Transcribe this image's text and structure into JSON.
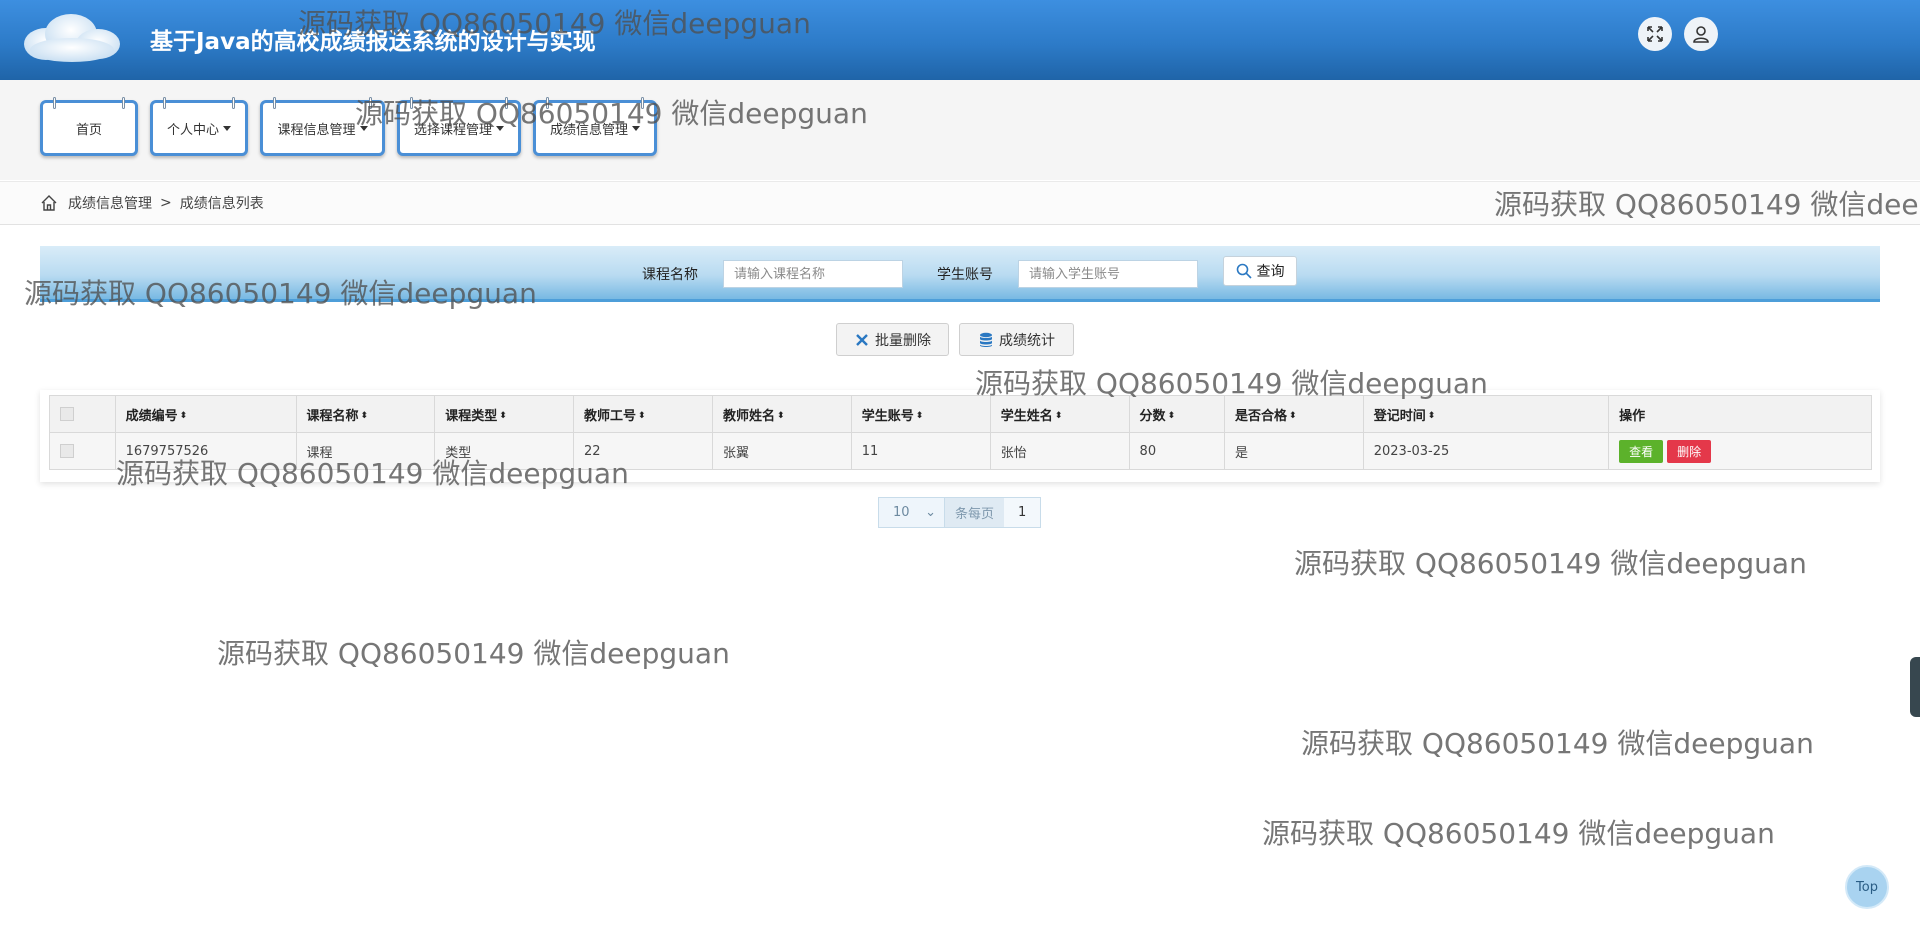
{
  "header": {
    "title": "基于Java的高校成绩报送系统的设计与实现",
    "fullscreen_icon": "expand-arrows-icon",
    "user_icon": "user-icon"
  },
  "nav": {
    "tabs": [
      {
        "label": "首页",
        "has_dropdown": false
      },
      {
        "label": "个人中心",
        "has_dropdown": true
      },
      {
        "label": "课程信息管理",
        "has_dropdown": true
      },
      {
        "label": "选择课程管理",
        "has_dropdown": true
      },
      {
        "label": "成绩信息管理",
        "has_dropdown": true
      }
    ]
  },
  "breadcrumb": {
    "home_icon": "home-icon",
    "items": [
      "成绩信息管理",
      "成绩信息列表"
    ],
    "separator": ">"
  },
  "search": {
    "course_label": "课程名称",
    "course_placeholder": "请输入课程名称",
    "student_label": "学生账号",
    "student_placeholder": "请输入学生账号",
    "query_label": "查询"
  },
  "actions": {
    "batch_delete_label": "批量删除",
    "stats_label": "成绩统计"
  },
  "table": {
    "columns": [
      "成绩编号",
      "课程名称",
      "课程类型",
      "教师工号",
      "教师姓名",
      "学生账号",
      "学生姓名",
      "分数",
      "是否合格",
      "登记时间",
      "操作"
    ],
    "rows": [
      {
        "id": "1679757526",
        "course_name": "课程",
        "course_type": "类型",
        "teacher_id": "22",
        "teacher_name": "张翼",
        "student_account": "11",
        "student_name": "张怡",
        "score": "80",
        "passed": "是",
        "register_time": "2023-03-25",
        "view_label": "查看",
        "delete_label": "删除"
      }
    ]
  },
  "pagination": {
    "page_size": "10",
    "per_page_label": "条每页",
    "current_page": "1"
  },
  "watermark_text": "源码获取 QQ86050149 微信deepguan",
  "top_button_label": "Top",
  "colors": {
    "header_blue": "#2d7bc8",
    "nav_border": "#4a8fd6",
    "view_green": "#5cb22b",
    "delete_red": "#e4384a"
  }
}
